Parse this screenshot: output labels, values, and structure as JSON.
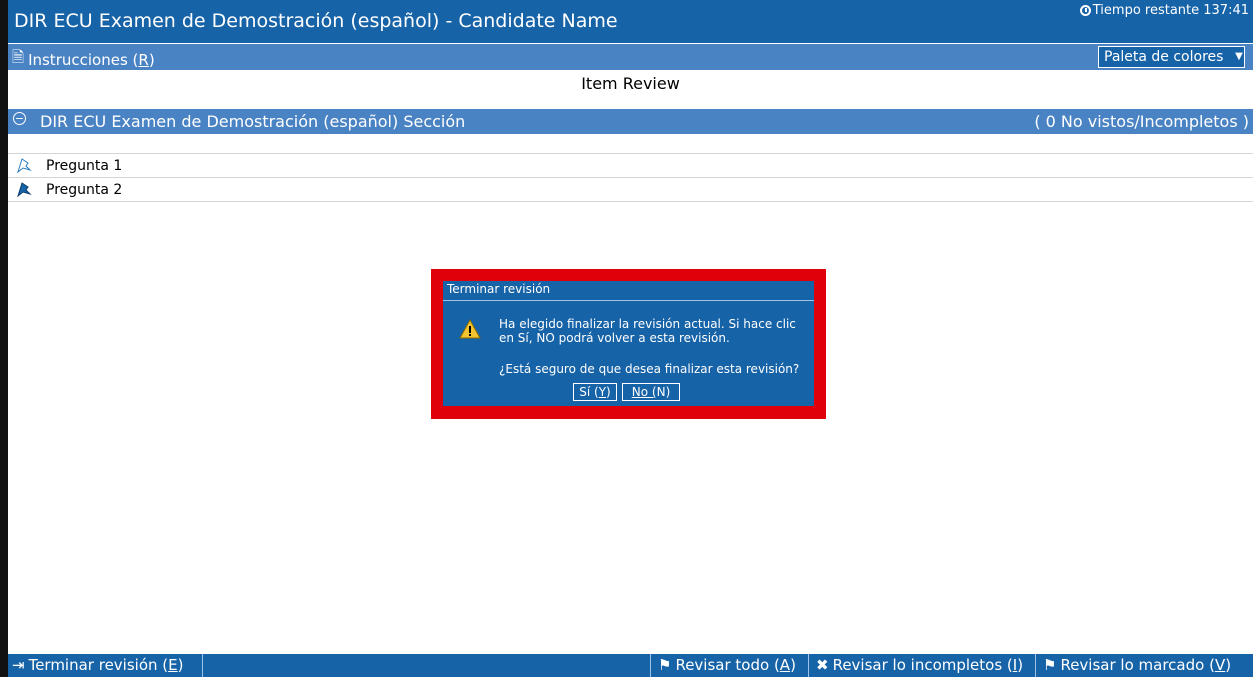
{
  "window": {
    "title": "DIR ECU Examen de Demostración (español) - Candidate Name",
    "timer_label": "Tiempo restante 137:41"
  },
  "instructions": {
    "label_prefix": "Instrucciones (",
    "label_key": "R",
    "label_suffix": ")",
    "icon": "document-icon"
  },
  "palette": {
    "selected": "Paleta de colores"
  },
  "review": {
    "title": "Item Review"
  },
  "section": {
    "name": "DIR ECU Examen de Demostración (español) Sección",
    "status": "( 0 No vistos/Incompletos )"
  },
  "questions": [
    {
      "label": "Pregunta 1",
      "flag": "outline-flag-icon",
      "flagged": false
    },
    {
      "label": "Pregunta 2",
      "flag": "filled-flag-icon",
      "flagged": true
    }
  ],
  "dialog": {
    "title": "Terminar revisión",
    "message": "Ha elegido finalizar la revisión actual. Si hace clic en Sí, NO podrá volver a esta revisión.",
    "confirm": "¿Está seguro de que desea finalizar esta revisión?",
    "yes_prefix": "Sí (",
    "yes_key": "Y",
    "no_prefix": "No (",
    "no_key": "N",
    "close_paren": ")"
  },
  "footer": {
    "end_prefix": "Terminar revisión (",
    "end_key": "E",
    "all_prefix": "Revisar todo (",
    "all_key": "A",
    "incomplete_prefix": "Revisar lo incompletos (",
    "incomplete_key": "I",
    "flagged_prefix": "Revisar lo marcado (",
    "flagged_key": "V",
    "close_paren": ")"
  },
  "colors": {
    "primary": "#1763a8",
    "secondary": "#4a83c4",
    "highlight": "#e0000a"
  }
}
